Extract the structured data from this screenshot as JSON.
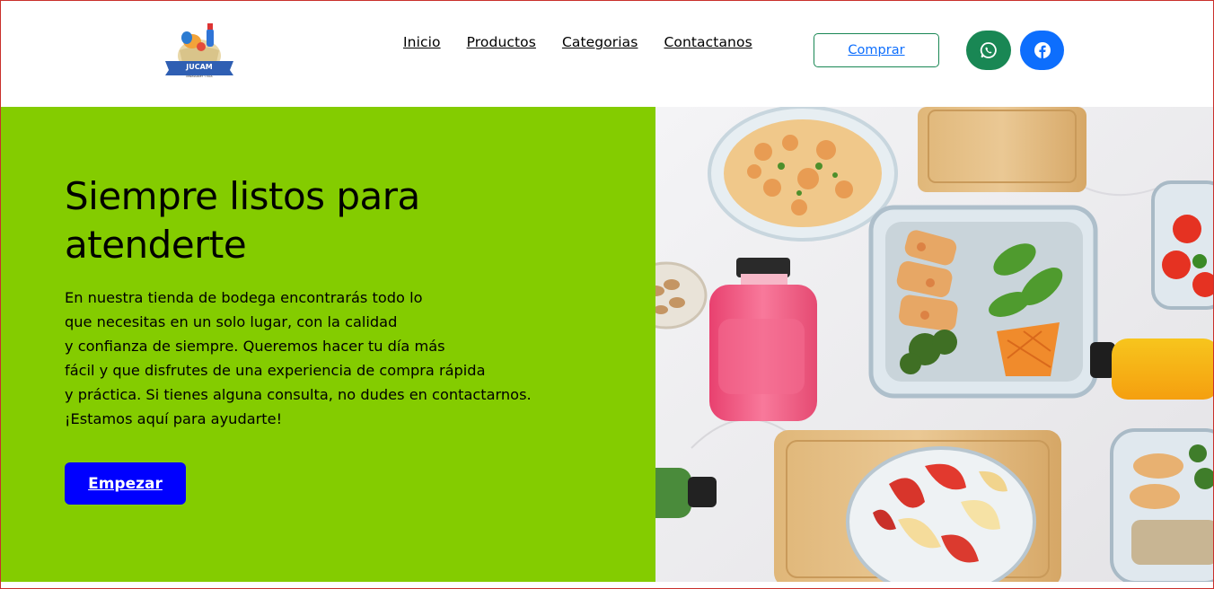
{
  "brand": {
    "logo_text": "JUCAM",
    "logo_subtext": "MINIMARKET Y MAS"
  },
  "nav": {
    "items": [
      {
        "label": "Inicio"
      },
      {
        "label": "Productos"
      },
      {
        "label": "Categorias"
      },
      {
        "label": "Contactanos"
      }
    ],
    "buy_label": "Comprar"
  },
  "social": [
    {
      "icon": "whatsapp-icon",
      "color": "#198754"
    },
    {
      "icon": "facebook-icon",
      "color": "#0d6efd"
    }
  ],
  "hero": {
    "title_line1": "Siempre listos para",
    "title_line2": "atenderte",
    "lines": [
      "En nuestra tienda de bodega encontrarás todo lo",
      "que necesitas en un solo lugar, con la calidad",
      "y confianza de siempre. Queremos hacer tu día más",
      "fácil y que disfrutes de una experiencia de compra rápida",
      "y práctica. Si tienes alguna consulta, no dudes en contactarnos.",
      "¡Estamos aquí para ayudarte!"
    ],
    "cta_label": "Empezar",
    "bg_color": "#84cc00",
    "cta_color": "#0000ff"
  },
  "hero_image": {
    "subject": "meal prep containers, juices and fruit on marble"
  }
}
